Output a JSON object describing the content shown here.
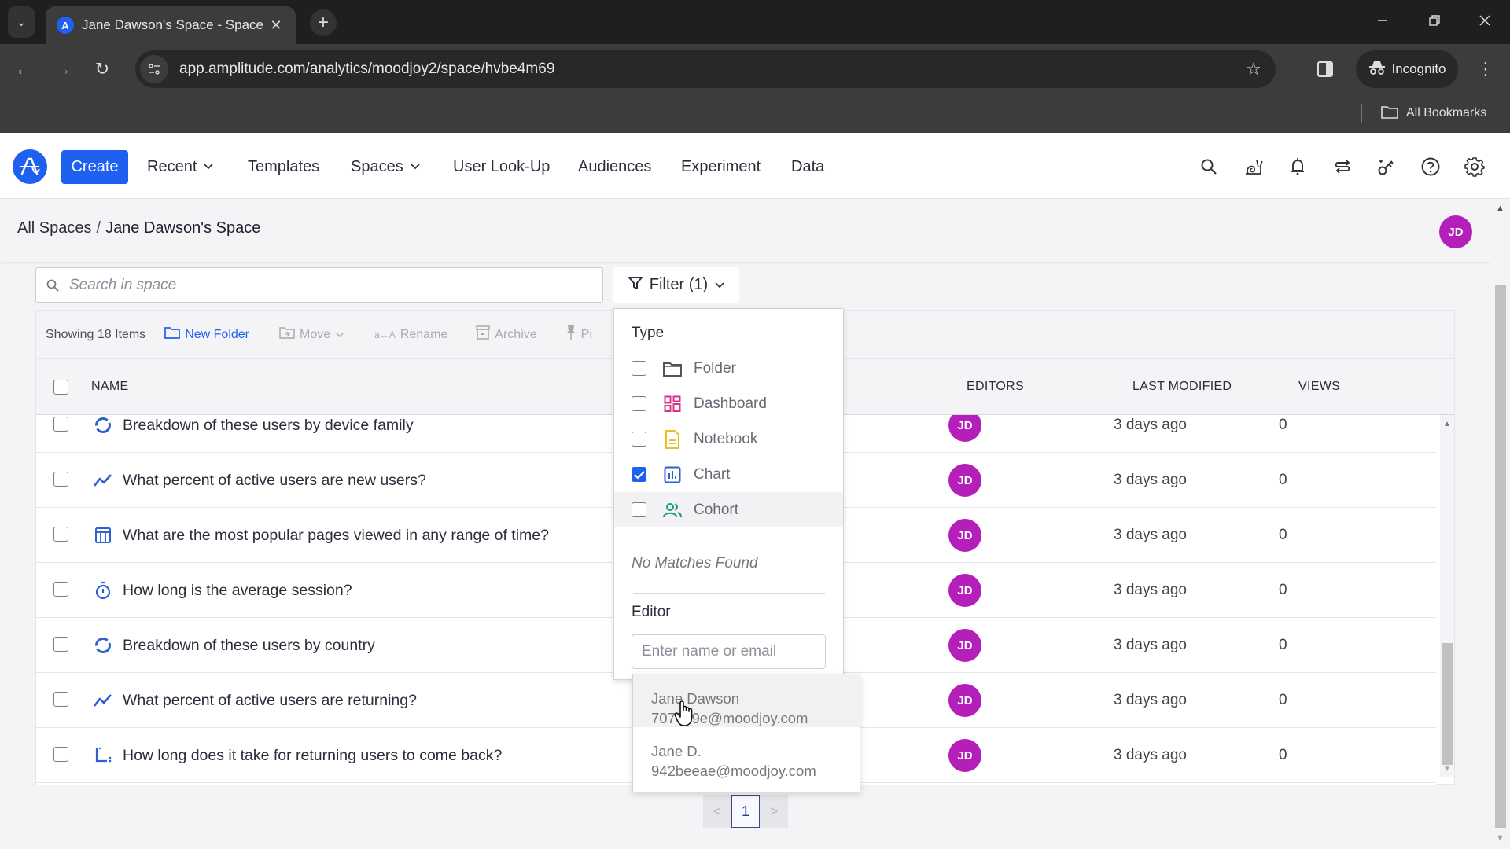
{
  "browser": {
    "tab_title": "Jane Dawson's Space - Space -",
    "url": "app.amplitude.com/analytics/moodjoy2/space/hvbe4m69",
    "profile_label": "Incognito",
    "bookmarks_label": "All Bookmarks",
    "icons": {
      "tab_list": "chevron-down-icon",
      "favicon": "amplitude-logo-icon",
      "tab_close": "close-icon",
      "new_tab": "plus-icon",
      "minimize": "minimize-icon",
      "restore": "restore-icon",
      "close_window": "close-icon",
      "back": "arrow-left-icon",
      "forward": "arrow-right-icon",
      "reload": "reload-icon",
      "site_settings": "tune-icon",
      "bookmark": "star-icon",
      "side_panel": "side-panel-icon",
      "incognito": "incognito-icon",
      "menu": "more-vertical-icon",
      "bookmarks_folder": "folder-icon"
    },
    "glyphs": {
      "tab_list": "⌄",
      "tab_close": "✕",
      "new_tab": "+",
      "minimize": "—",
      "restore": "❐",
      "close_window": "✕",
      "back": "←",
      "forward": "→",
      "reload": "↻",
      "star": "☆",
      "menu": "⋮"
    }
  },
  "app_nav": {
    "create_label": "Create",
    "items": [
      {
        "label": "Recent",
        "has_chevron": true
      },
      {
        "label": "Templates",
        "has_chevron": false
      },
      {
        "label": "Spaces",
        "has_chevron": true
      },
      {
        "label": "User Look-Up",
        "has_chevron": false
      },
      {
        "label": "Audiences",
        "has_chevron": false
      },
      {
        "label": "Experiment",
        "has_chevron": false
      },
      {
        "label": "Data",
        "has_chevron": false
      }
    ],
    "chevron_glyph": "⌄",
    "right_icons": [
      "search-icon",
      "snail-icon",
      "bell-icon",
      "transfer-icon",
      "key-sparkle-icon",
      "help-icon",
      "gear-icon"
    ]
  },
  "breadcrumb": {
    "root": "All Spaces",
    "separator": "/",
    "current": "Jane Dawson's Space"
  },
  "user": {
    "initials": "JD",
    "avatar_color": "#b51fb9"
  },
  "search": {
    "placeholder": "Search in space",
    "value": ""
  },
  "filter": {
    "label": "Filter (1)",
    "type_heading": "Type",
    "types": [
      {
        "label": "Folder",
        "icon": "folder-icon",
        "checked": false,
        "color": "#555555"
      },
      {
        "label": "Dashboard",
        "icon": "dashboard-icon",
        "checked": false,
        "color": "#d6338a"
      },
      {
        "label": "Notebook",
        "icon": "notebook-icon",
        "checked": false,
        "color": "#e6c229"
      },
      {
        "label": "Chart",
        "icon": "chart-icon",
        "checked": true,
        "color": "#2f5fd0"
      },
      {
        "label": "Cohort",
        "icon": "cohort-icon",
        "checked": false,
        "color": "#1a9a7a"
      }
    ],
    "no_matches": "No Matches Found",
    "editor_heading": "Editor",
    "editor_placeholder": "Enter name or email",
    "editor_value": "",
    "editor_suggestions": [
      {
        "name": "Jane Dawson",
        "email": "707?d9e@moodjoy.com"
      },
      {
        "name": "Jane D.",
        "email": "942beeae@moodjoy.com"
      }
    ]
  },
  "toolbar": {
    "count_text": "Showing 18 Items",
    "new_folder": "New Folder",
    "move": "Move",
    "rename": "Rename",
    "archive": "Archive",
    "pin": "Pi"
  },
  "table": {
    "columns": {
      "name": "NAME",
      "editors": "EDITORS",
      "last_modified": "LAST MODIFIED",
      "views": "VIEWS"
    },
    "rows": [
      {
        "name": "Breakdown of these users by device family",
        "icon": "donut-chart-icon",
        "editor": "JD",
        "modified": "3 days ago",
        "views": "0"
      },
      {
        "name": "What percent of active users are new users?",
        "icon": "line-chart-icon",
        "editor": "JD",
        "modified": "3 days ago",
        "views": "0"
      },
      {
        "name": "What are the most popular pages viewed in any range of time?",
        "icon": "table-chart-icon",
        "editor": "JD",
        "modified": "3 days ago",
        "views": "0"
      },
      {
        "name": "How long is the average session?",
        "icon": "stopwatch-icon",
        "editor": "JD",
        "modified": "3 days ago",
        "views": "0"
      },
      {
        "name": "Breakdown of these users by country",
        "icon": "donut-chart-icon",
        "editor": "JD",
        "modified": "3 days ago",
        "views": "0"
      },
      {
        "name": "What percent of active users are returning?",
        "icon": "line-chart-icon",
        "editor": "JD",
        "modified": "3 days ago",
        "views": "0"
      },
      {
        "name": "How long does it take for returning users to come back?",
        "icon": "retention-chart-icon",
        "editor": "JD",
        "modified": "3 days ago",
        "views": "0"
      }
    ]
  },
  "pagination": {
    "prev": "<",
    "current": "1",
    "next": ">"
  },
  "colors": {
    "brand": "#1e61f0",
    "avatar": "#b51fb9",
    "chart_icon": "#2f5fd0"
  }
}
